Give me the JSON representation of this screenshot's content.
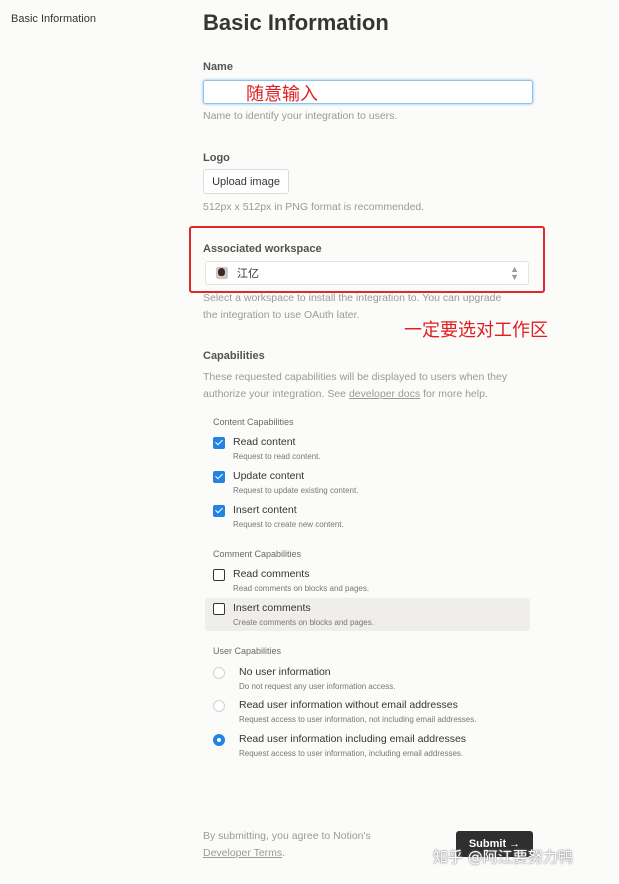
{
  "sidebar": {
    "active_item": "Basic Information"
  },
  "page": {
    "title": "Basic Information"
  },
  "name_field": {
    "label": "Name",
    "value": "",
    "help": "Name to identify your integration to users."
  },
  "logo": {
    "label": "Logo",
    "button": "Upload image",
    "help": "512px x 512px in PNG format is recommended."
  },
  "workspace": {
    "label": "Associated workspace",
    "selected": "江亿",
    "help_line1": "Select a workspace to install the integration to. You can upgrade",
    "help_line2": "the integration to use OAuth later."
  },
  "annotations": {
    "name_hint": "随意输入",
    "workspace_hint": "一定要选对工作区",
    "accent_color": "#e02020"
  },
  "capabilities": {
    "label": "Capabilities",
    "help_line1": "These requested capabilities will be displayed to users when they",
    "help_line2_prefix": "authorize your integration. See ",
    "help_link": "developer docs",
    "help_line2_suffix": " for more help.",
    "content": {
      "heading": "Content Capabilities",
      "items": [
        {
          "title": "Read content",
          "desc": "Request to read content.",
          "checked": true
        },
        {
          "title": "Update content",
          "desc": "Request to update existing content.",
          "checked": true
        },
        {
          "title": "Insert content",
          "desc": "Request to create new content.",
          "checked": true
        }
      ]
    },
    "comment": {
      "heading": "Comment Capabilities",
      "items": [
        {
          "title": "Read comments",
          "desc": "Read comments on blocks and pages.",
          "checked": false
        },
        {
          "title": "Insert comments",
          "desc": "Create comments on blocks and pages.",
          "checked": false
        }
      ]
    },
    "user": {
      "heading": "User Capabilities",
      "items": [
        {
          "title": "No user information",
          "desc": "Do not request any user information access.",
          "selected": false
        },
        {
          "title": "Read user information without email addresses",
          "desc": "Request access to user information, not including email addresses.",
          "selected": false
        },
        {
          "title": "Read user information including email addresses",
          "desc": "Request access to user information, including email addresses.",
          "selected": true
        }
      ]
    }
  },
  "footer": {
    "line1": "By submitting, you agree to Notion's",
    "link": "Developer Terms",
    "link_suffix": ".",
    "submit": "Submit →"
  },
  "watermark": "知乎 @阿江要努力鸭",
  "colors": {
    "checkbox_blue": "#2383e2",
    "highlight_border": "#e02828",
    "submit_bg": "#2f2f2f"
  }
}
